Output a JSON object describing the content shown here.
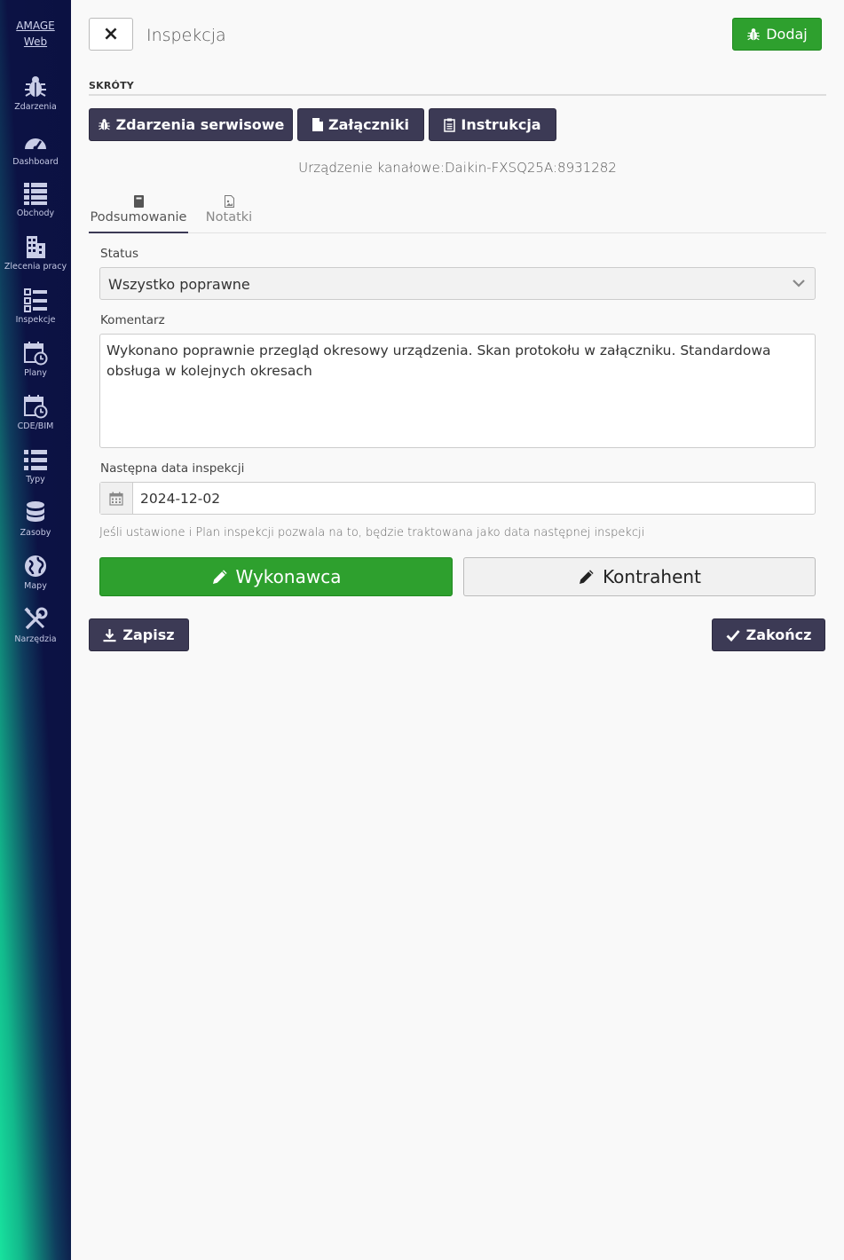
{
  "sidebar": {
    "brand_line1": "AMAGE",
    "brand_line2": "Web",
    "items": [
      {
        "label": "Zdarzenia",
        "icon": "bug-icon"
      },
      {
        "label": "Dashboard",
        "icon": "gauge-icon"
      },
      {
        "label": "Obchody",
        "icon": "list-icon"
      },
      {
        "label": "Zlecenia pracy",
        "icon": "building-icon"
      },
      {
        "label": "Inspekcje",
        "icon": "checklist-icon"
      },
      {
        "label": "Plany",
        "icon": "calendar-clock-icon"
      },
      {
        "label": "CDE/BIM",
        "icon": "calendar-clock-icon"
      },
      {
        "label": "Typy",
        "icon": "list-icon"
      },
      {
        "label": "Zasoby",
        "icon": "database-icon"
      },
      {
        "label": "Mapy",
        "icon": "globe-icon"
      },
      {
        "label": "Narzędzia",
        "icon": "tools-icon"
      }
    ]
  },
  "header": {
    "close_label": "×",
    "title": "Inspekcja",
    "add_label": "Dodaj"
  },
  "shortcuts": {
    "heading": "SKRÓTY",
    "items": [
      {
        "label": "Zdarzenia serwisowe",
        "icon": "bug-icon"
      },
      {
        "label": "Załączniki",
        "icon": "file-icon"
      },
      {
        "label": "Instrukcja",
        "icon": "clipboard-icon"
      }
    ]
  },
  "device_line": "Urządzenie kanałowe:Daikin-FXSQ25A:8931282",
  "tabs": [
    {
      "label": "Podsumowanie",
      "icon": "book-icon",
      "active": true
    },
    {
      "label": "Notatki",
      "icon": "file-image-icon",
      "active": false
    }
  ],
  "form": {
    "status_label": "Status",
    "status_value": "Wszystko poprawne",
    "comment_label": "Komentarz",
    "comment_value": "Wykonano poprawnie przegląd okresowy urządzenia. Skan protokołu w załączniku. Standardowa obsługa w kolejnych okresach",
    "next_date_label": "Następna data inspekcji",
    "next_date_value": "2024-12-02",
    "hint": "Jeśli ustawione i Plan inspekcji pozwala na to, będzie traktowana jako data następnej inspekcji",
    "executor_label": "Wykonawca",
    "contractor_label": "Kontrahent"
  },
  "footer": {
    "save_label": "Zapisz",
    "finish_label": "Zakończ"
  },
  "colors": {
    "accent_green": "#2ea02e",
    "dark_button": "#3c3a55",
    "sidebar_dark": "#0b1142",
    "sidebar_teal": "#18e29e"
  }
}
